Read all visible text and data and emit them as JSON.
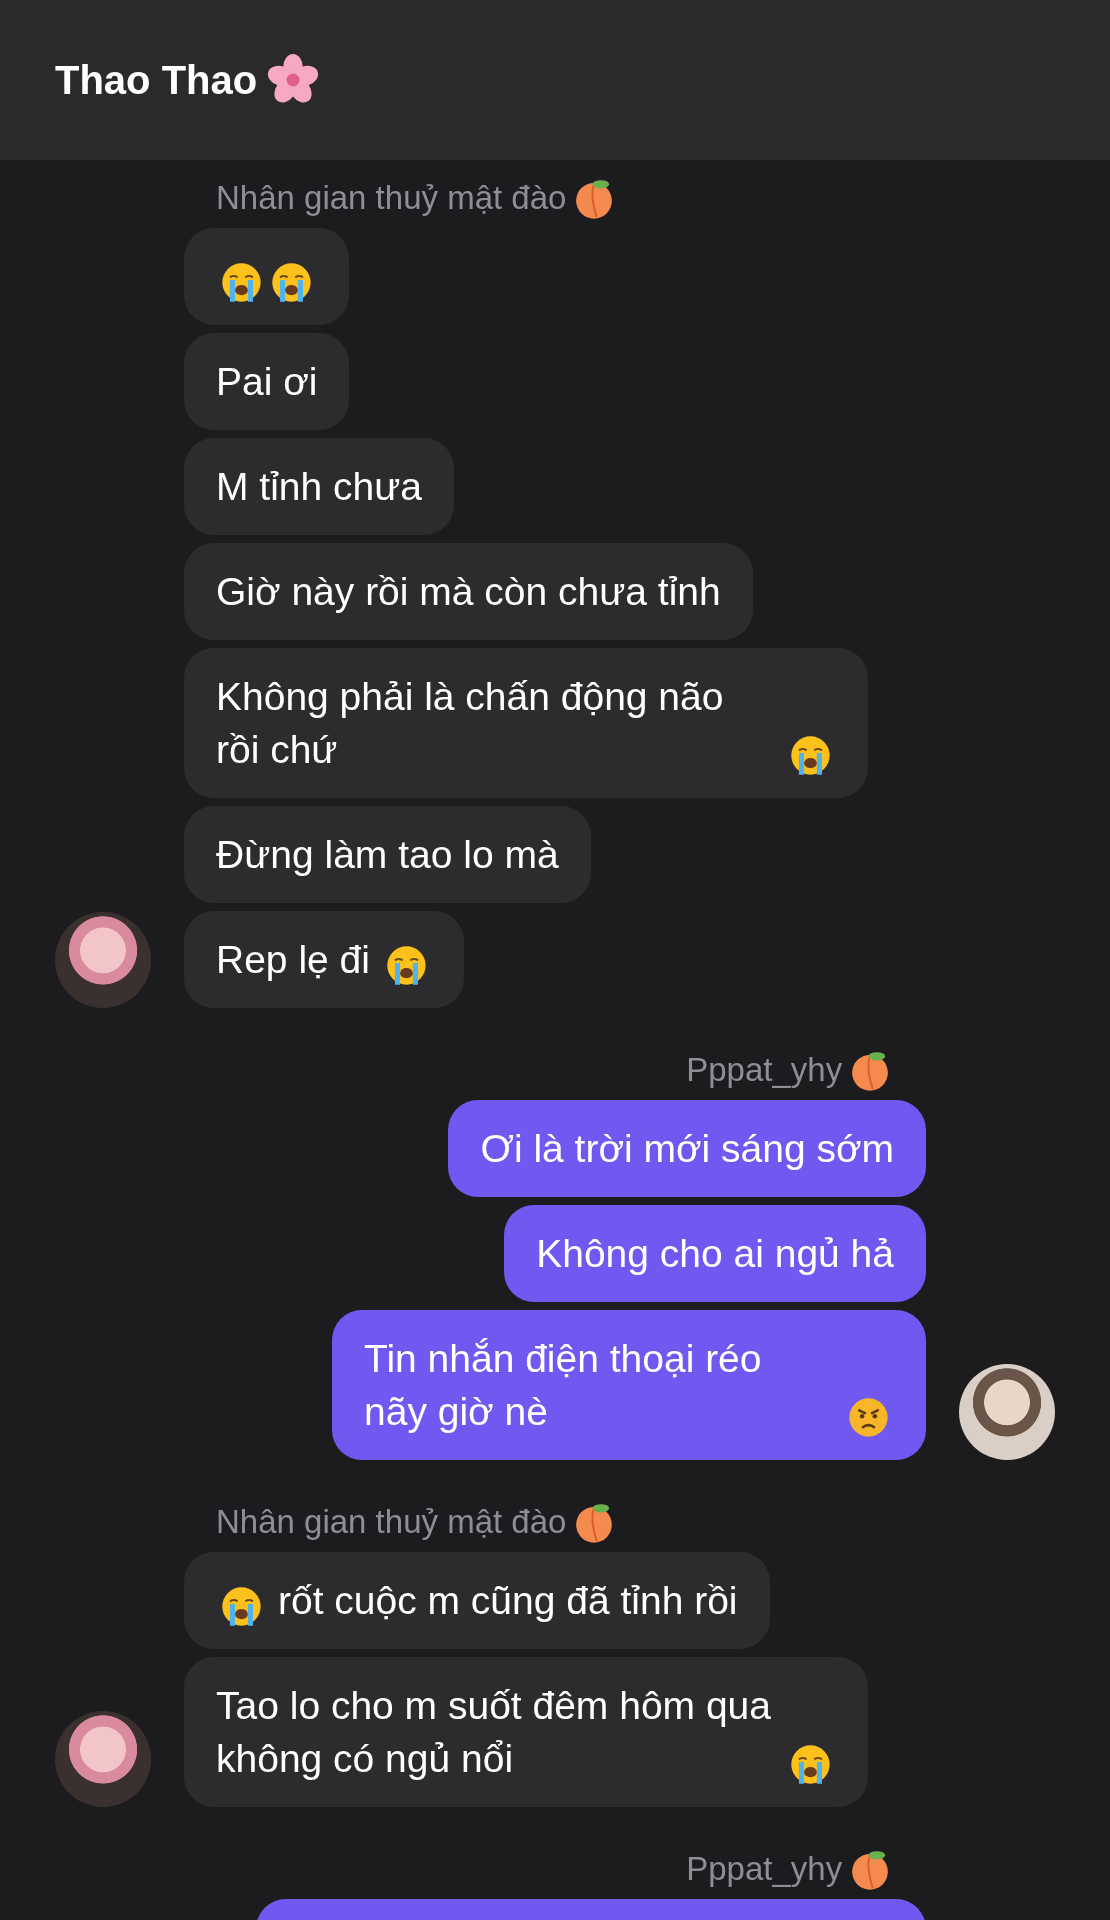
{
  "header": {
    "title": "Thao Thao",
    "badge": {
      "kind": "flower"
    }
  },
  "groups": [
    {
      "kind": "incoming",
      "sender": {
        "name": "Nhân gian thuỷ mật đào",
        "badge": {
          "kind": "peach"
        }
      },
      "avatar": true,
      "messages": [
        {
          "segments": [
            {
              "kind": "crying"
            },
            {
              "kind": "crying"
            }
          ]
        },
        {
          "segments": [
            {
              "kind": "text",
              "text": "Pai ơi"
            }
          ]
        },
        {
          "segments": [
            {
              "kind": "text",
              "text": "M tỉnh chưa"
            }
          ]
        },
        {
          "segments": [
            {
              "kind": "text",
              "text": "Giờ này rồi mà còn chưa tỉnh"
            }
          ]
        },
        {
          "segments": [
            {
              "kind": "text",
              "text": "Không phải là chấn động não rồi chứ"
            },
            {
              "kind": "crying"
            }
          ]
        },
        {
          "segments": [
            {
              "kind": "text",
              "text": "Đừng làm tao lo mà"
            }
          ]
        },
        {
          "segments": [
            {
              "kind": "text",
              "text": "Rep lẹ đi"
            },
            {
              "kind": "crying"
            }
          ]
        }
      ]
    },
    {
      "kind": "outgoing",
      "sender": {
        "name": "Pppat_yhy",
        "badge": {
          "kind": "peach"
        }
      },
      "avatar": true,
      "messages": [
        {
          "segments": [
            {
              "kind": "text",
              "text": "Ơi là trời mới sáng sớm"
            }
          ]
        },
        {
          "segments": [
            {
              "kind": "text",
              "text": "Không cho ai ngủ hả"
            }
          ]
        },
        {
          "segments": [
            {
              "kind": "text",
              "text": "Tin nhắn điện thoại réo nãy giờ nè"
            },
            {
              "kind": "angry"
            }
          ]
        }
      ]
    },
    {
      "kind": "incoming",
      "sender": {
        "name": "Nhân gian thuỷ mật đào",
        "badge": {
          "kind": "peach"
        }
      },
      "avatar": true,
      "messages": [
        {
          "segments": [
            {
              "kind": "crying"
            },
            {
              "kind": "text",
              "text": "rốt cuộc m cũng đã tỉnh rồi"
            }
          ]
        },
        {
          "segments": [
            {
              "kind": "text",
              "text": "Tao lo cho m suốt đêm hôm qua không có ngủ nổi"
            },
            {
              "kind": "crying"
            }
          ]
        }
      ]
    },
    {
      "kind": "outgoing",
      "sender": {
        "name": "Pppat_yhy",
        "badge": {
          "kind": "peach"
        }
      },
      "avatar": false,
      "cut_off": true
    }
  ]
}
